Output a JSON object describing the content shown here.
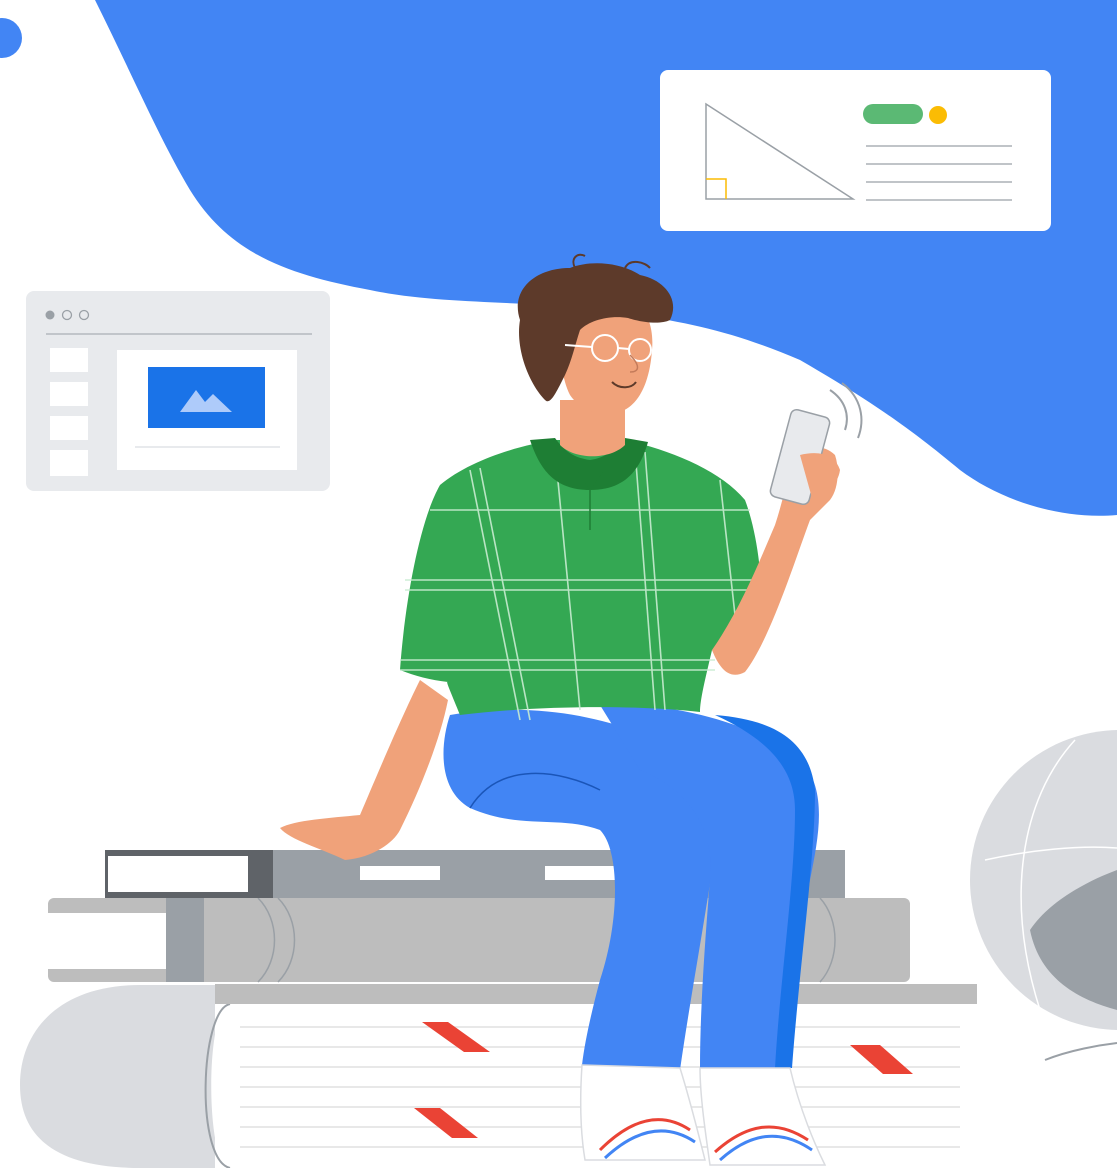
{
  "colors": {
    "blob_blue": "#4285f4",
    "shirt_green": "#34a853",
    "collar_green": "#1e7e34",
    "pants_blue": "#4285f4",
    "pants_dark": "#1a73e8",
    "skin": "#f0a27a",
    "hair": "#5d3a2a",
    "book_gray": "#bdbdbd",
    "book_dark": "#757575",
    "bookmark_red": "#ea4335",
    "accent_green": "#5bb974",
    "accent_yellow": "#fbbc04",
    "image_blue": "#1a73e8",
    "card_white": "#ffffff",
    "window_gray": "#e8eaed",
    "globe_gray": "#bdbdbd"
  },
  "icons": {
    "image_placeholder": "mountain-image-icon",
    "phone": "smartphone-icon",
    "window_dots": "window-traffic-dots-icon"
  }
}
